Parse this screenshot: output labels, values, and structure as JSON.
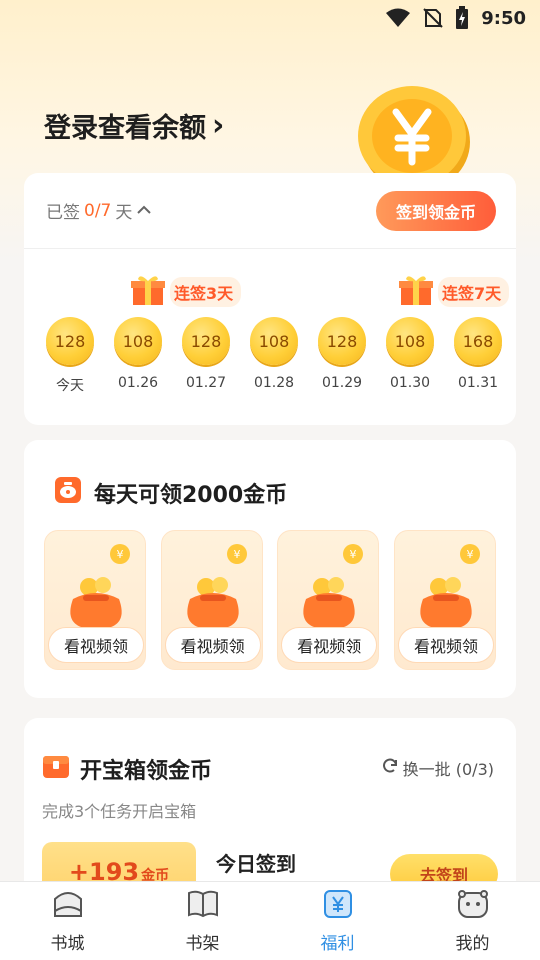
{
  "status_bar": {
    "time": "9:50",
    "icons": [
      "wifi-icon",
      "no-sim-icon",
      "battery-charging-icon"
    ]
  },
  "header": {
    "login_text": "登录查看余额",
    "arrow": "›"
  },
  "checkin": {
    "signed_prefix": "已签",
    "signed_count": "0/7",
    "signed_suffix": "天",
    "sign_button": "签到领金币",
    "milestones": [
      {
        "label": "连签3天"
      },
      {
        "label": "连签7天"
      }
    ],
    "days": [
      {
        "coins": "128",
        "date": "今天"
      },
      {
        "coins": "108",
        "date": "01.26"
      },
      {
        "coins": "128",
        "date": "01.27"
      },
      {
        "coins": "108",
        "date": "01.28"
      },
      {
        "coins": "128",
        "date": "01.29"
      },
      {
        "coins": "108",
        "date": "01.30"
      },
      {
        "coins": "168",
        "date": "01.31"
      }
    ]
  },
  "video_section": {
    "title": "每天可领2000金币",
    "items": [
      {
        "label": "看视频领"
      },
      {
        "label": "看视频领"
      },
      {
        "label": "看视频领"
      },
      {
        "label": "看视频领"
      }
    ]
  },
  "treasure_section": {
    "title": "开宝箱领金币",
    "refresh_label": "换一批 (0/3)",
    "subtitle": "完成3个任务开启宝箱",
    "task": {
      "reward_amount": "+193",
      "reward_unit": "金币",
      "name": "今日签到",
      "button": "去签到"
    }
  },
  "bottom_nav": [
    {
      "label": "书城",
      "icon": "bookstore-icon",
      "active": false
    },
    {
      "label": "书架",
      "icon": "bookshelf-icon",
      "active": false
    },
    {
      "label": "福利",
      "icon": "welfare-icon",
      "active": true
    },
    {
      "label": "我的",
      "icon": "profile-icon",
      "active": false
    }
  ],
  "colors": {
    "accent": "#ff5d3a",
    "coin": "#ffcf38",
    "nav_active": "#2f8fe3"
  }
}
